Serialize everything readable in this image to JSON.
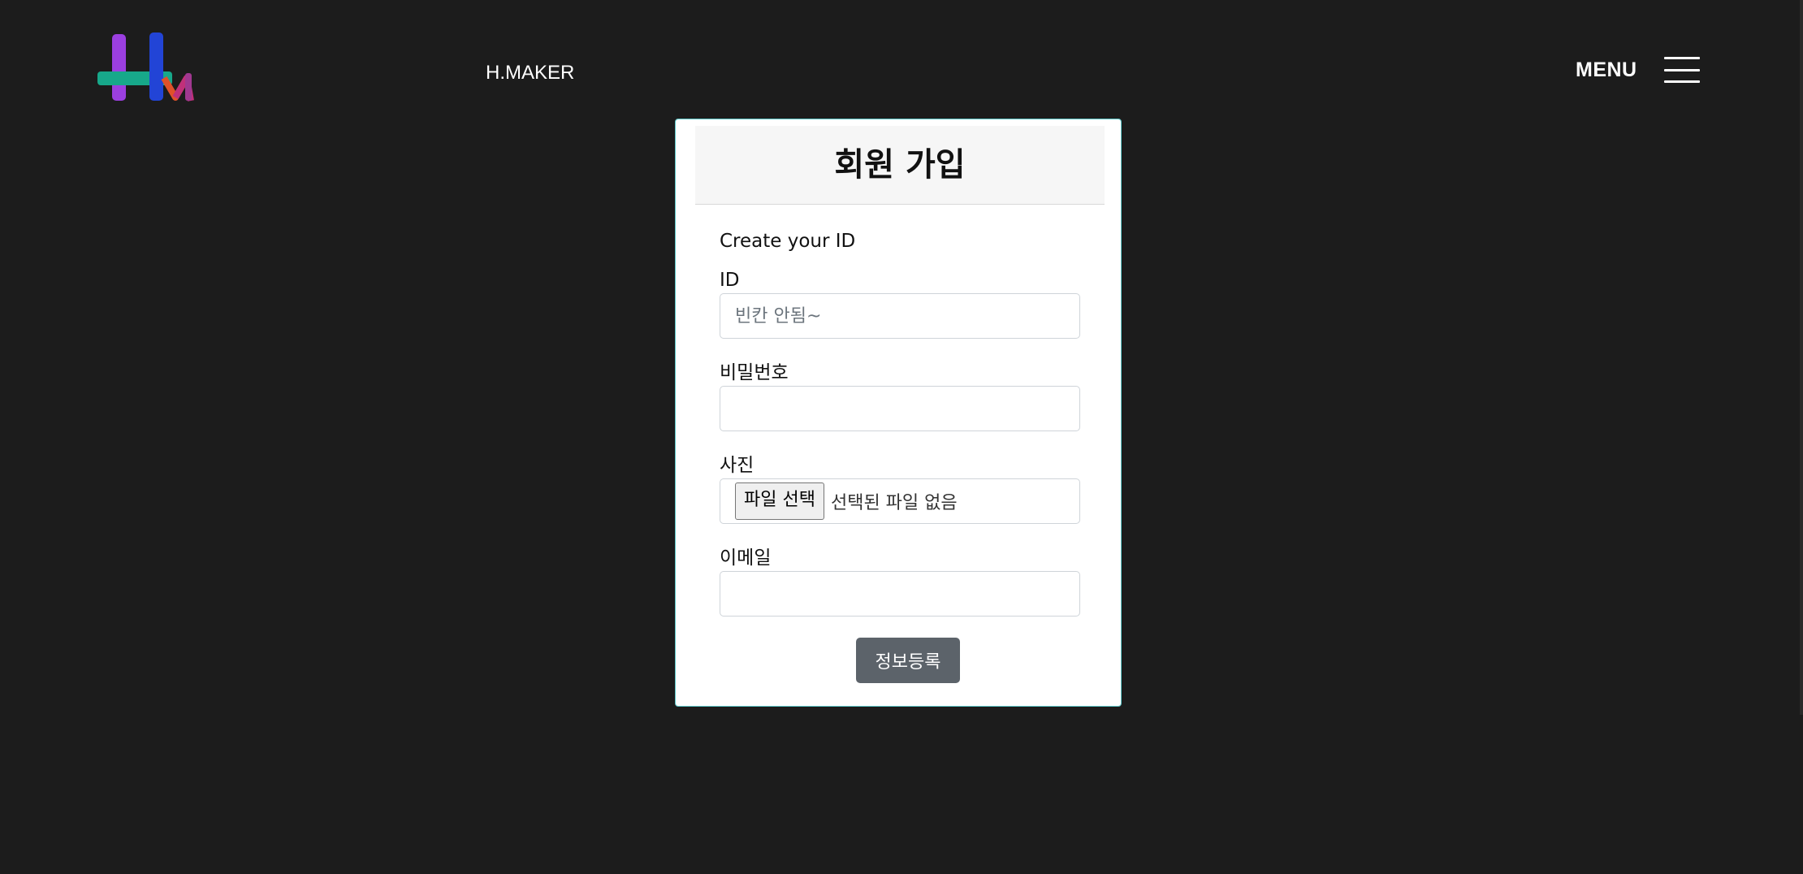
{
  "header": {
    "brand": "H.MAKER",
    "menu_label": "MENU",
    "logo_icon": "hm-logo-icon",
    "menu_icon": "hamburger-icon"
  },
  "signup": {
    "title": "회원 가입",
    "subtitle": "Create your ID",
    "id_label": "ID",
    "id_placeholder": "빈칸 안됨~",
    "id_value": "",
    "password_label": "비밀번호",
    "password_value": "",
    "photo_label": "사진",
    "file_button_label": "파일 선택",
    "file_status": "선택된 파일 없음",
    "email_label": "이메일",
    "email_value": "",
    "submit_label": "정보등록"
  },
  "colors": {
    "background": "#1c1c1c",
    "card_border": "#5fc7c9",
    "submit_button": "#5c636a",
    "logo_purple": "#9b3fe0",
    "logo_teal": "#17a88a",
    "logo_blue": "#2244d6",
    "logo_orange": "#e0512a",
    "logo_magenta": "#c0307a"
  }
}
